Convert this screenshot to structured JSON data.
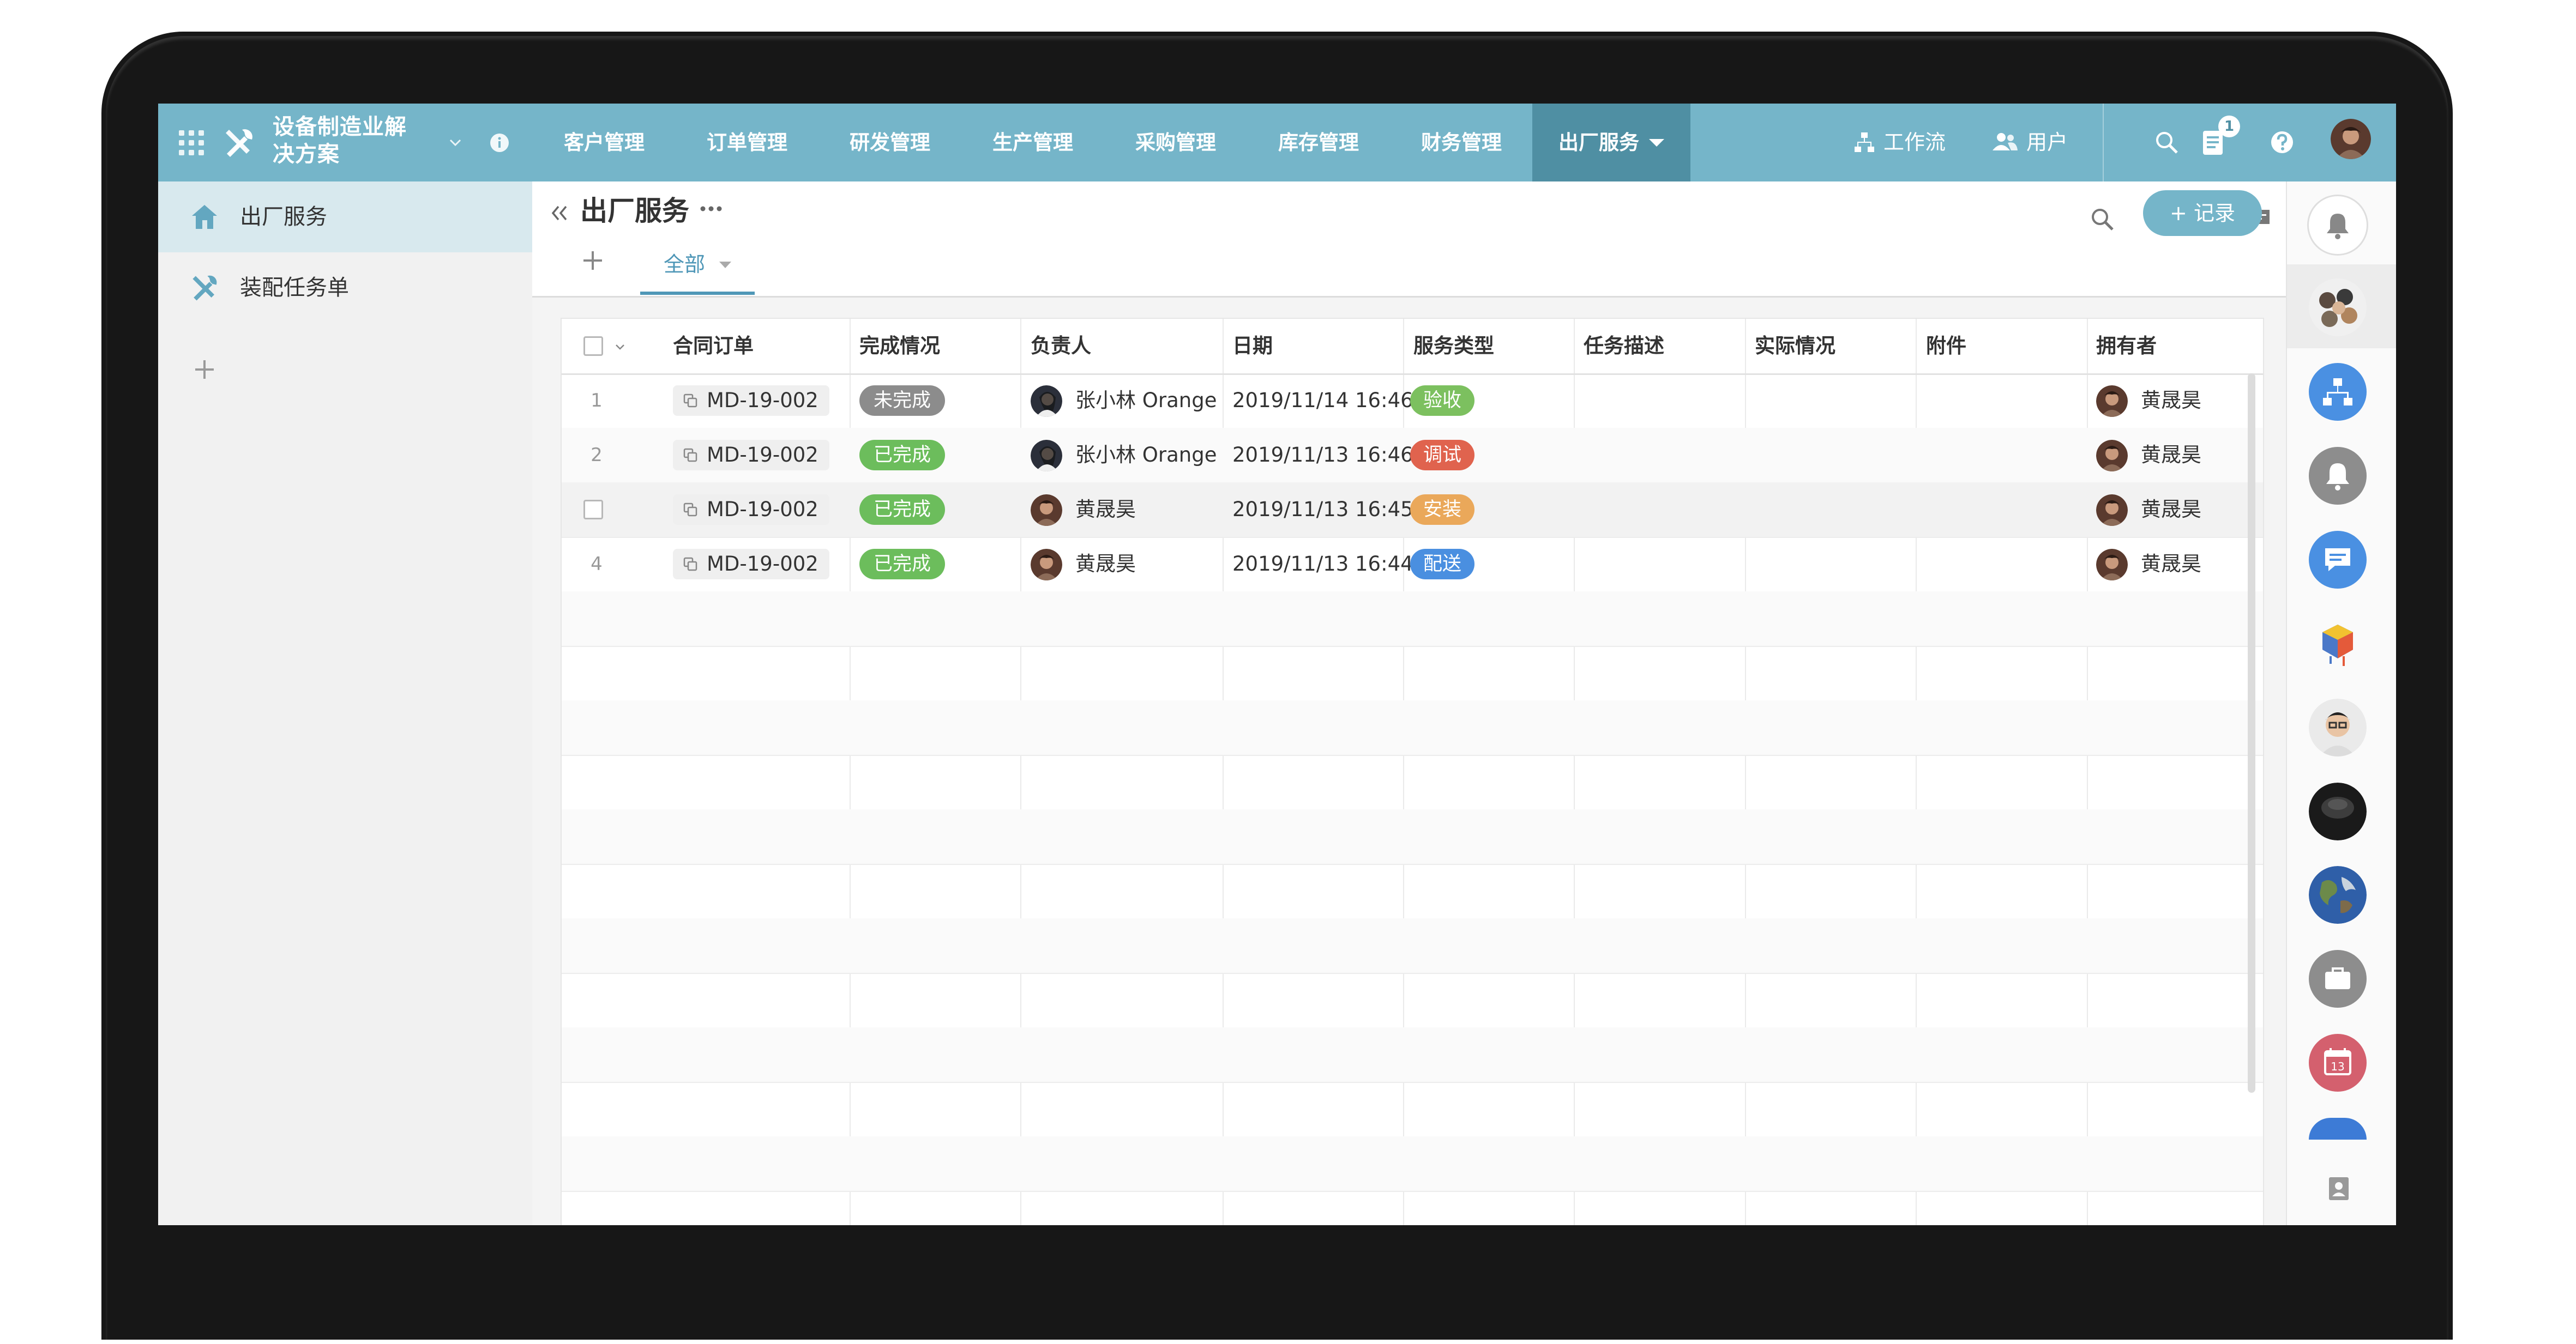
{
  "app": {
    "title_line1": "设备制造业解",
    "title_line2": "决方案"
  },
  "nav": {
    "items": [
      "客户管理",
      "订单管理",
      "研发管理",
      "生产管理",
      "采购管理",
      "库存管理",
      "财务管理"
    ],
    "active": "出厂服务"
  },
  "topbar": {
    "workflow": "工作流",
    "users": "用户",
    "notification_count": "1"
  },
  "sidebar": {
    "items": [
      "出厂服务",
      "装配任务单"
    ]
  },
  "page": {
    "title": "出厂服务",
    "tab_all": "全部",
    "add_record": "+ 记录"
  },
  "table": {
    "columns": [
      "合同订单",
      "完成情况",
      "负责人",
      "日期",
      "服务类型",
      "任务描述",
      "实际情况",
      "附件",
      "拥有者"
    ],
    "rows": [
      {
        "num": "1",
        "order": "MD-19-002",
        "status": "未完成",
        "owner": "张小林 Orange",
        "date": "2019/11/14 16:46",
        "type": "验收",
        "holder": "黄晟昊"
      },
      {
        "num": "2",
        "order": "MD-19-002",
        "status": "已完成",
        "owner": "张小林 Orange",
        "date": "2019/11/13 16:46",
        "type": "调试",
        "holder": "黄晟昊"
      },
      {
        "num": "",
        "order": "MD-19-002",
        "status": "已完成",
        "owner": "黄晟昊",
        "date": "2019/11/13 16:45",
        "type": "安装",
        "holder": "黄晟昊"
      },
      {
        "num": "4",
        "order": "MD-19-002",
        "status": "已完成",
        "owner": "黄晟昊",
        "date": "2019/11/13 16:44",
        "type": "配送",
        "holder": "黄晟昊"
      }
    ]
  },
  "rail": {
    "calendar_day": "13"
  },
  "colors": {
    "header": "#75b5c9",
    "header_active": "#4f8fa3",
    "status_pending": "#8c8c8c",
    "status_done": "#6cbd5c",
    "type_accept": "#7cc05f",
    "type_debug": "#e0634e",
    "type_install": "#eaa85a",
    "type_delivery": "#4a8fe0"
  }
}
